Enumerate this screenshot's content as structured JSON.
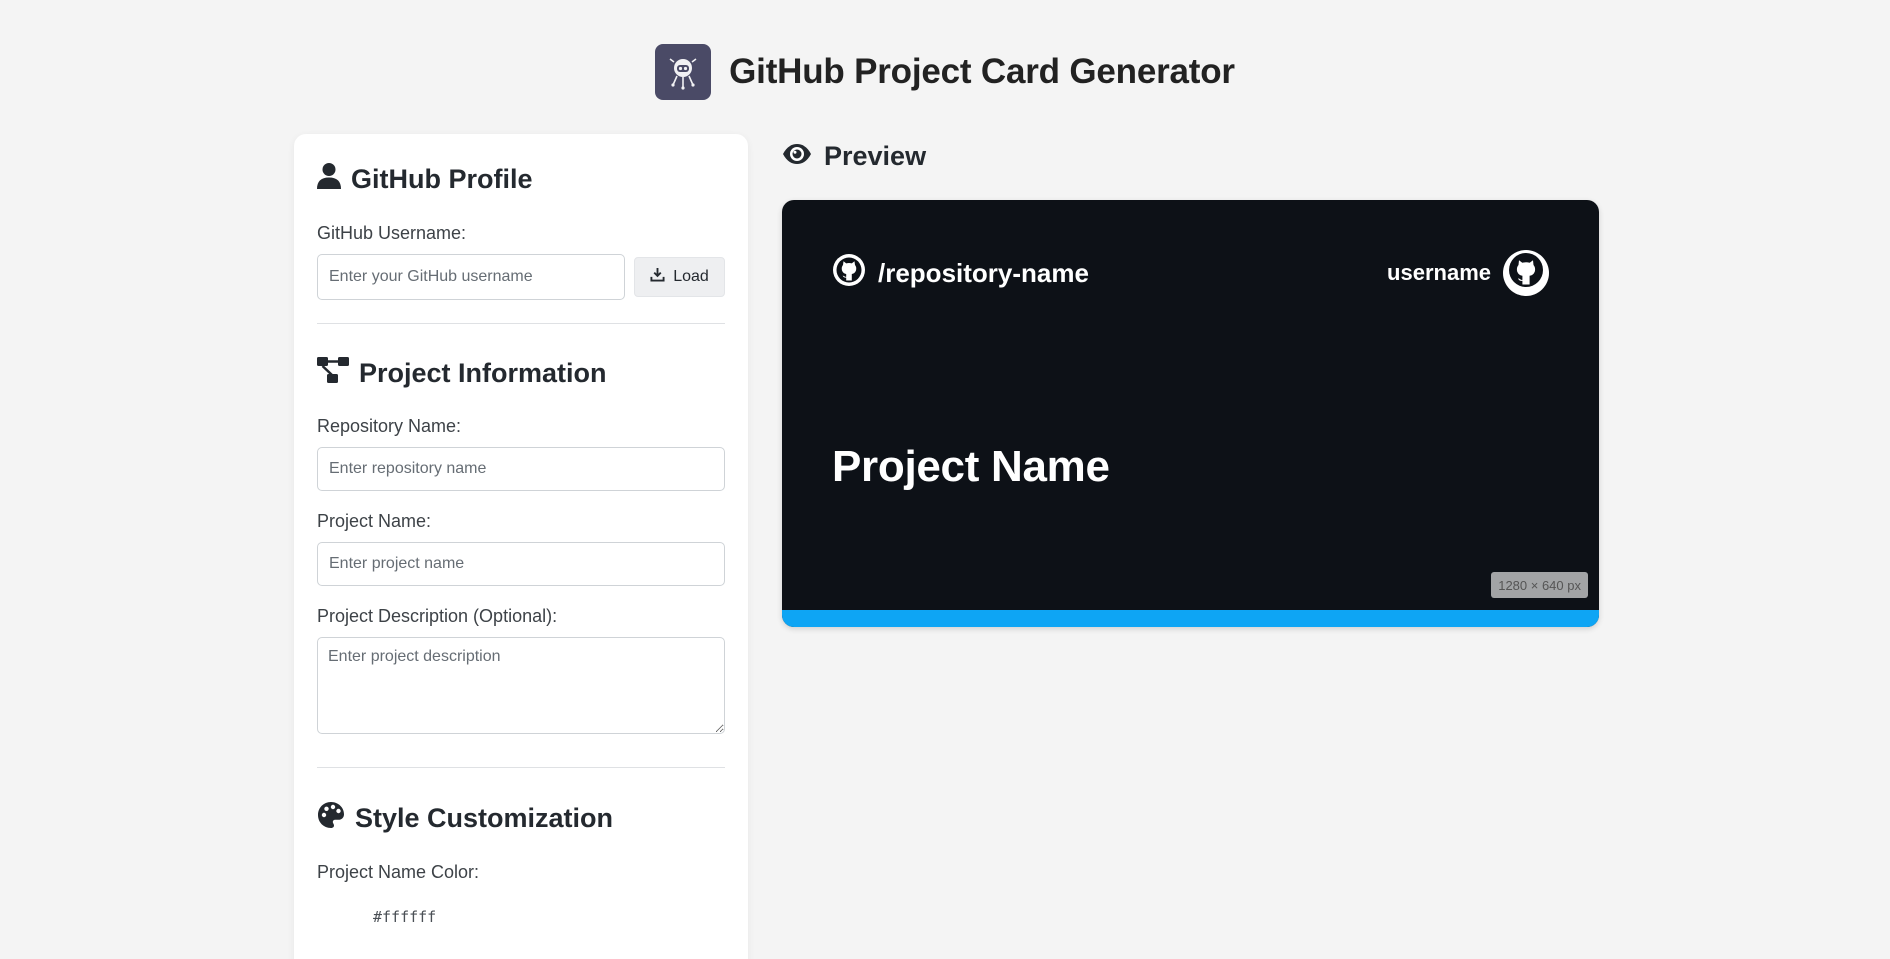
{
  "app": {
    "title": "GitHub Project Card Generator",
    "logo_icon": "octocat-robot-icon"
  },
  "profile": {
    "heading": "GitHub Profile",
    "username_label": "GitHub Username:",
    "username_value": "",
    "username_placeholder": "Enter your GitHub username",
    "load_label": "Load"
  },
  "project": {
    "heading": "Project Information",
    "repo_label": "Repository Name:",
    "repo_value": "",
    "repo_placeholder": "Enter repository name",
    "name_label": "Project Name:",
    "name_value": "",
    "name_placeholder": "Enter project name",
    "desc_label": "Project Description (Optional):",
    "desc_value": "",
    "desc_placeholder": "Enter project description"
  },
  "style": {
    "heading": "Style Customization",
    "name_color_label": "Project Name Color:",
    "name_color_value": "#ffffff"
  },
  "preview": {
    "heading": "Preview",
    "card": {
      "repo_text": "/repository-name",
      "username_text": "username",
      "project_name": "Project Name",
      "size_badge": "1280 × 640 px",
      "background_color": "#0d1117",
      "accent_color": "#0ea5f4",
      "text_color": "#ffffff"
    }
  }
}
